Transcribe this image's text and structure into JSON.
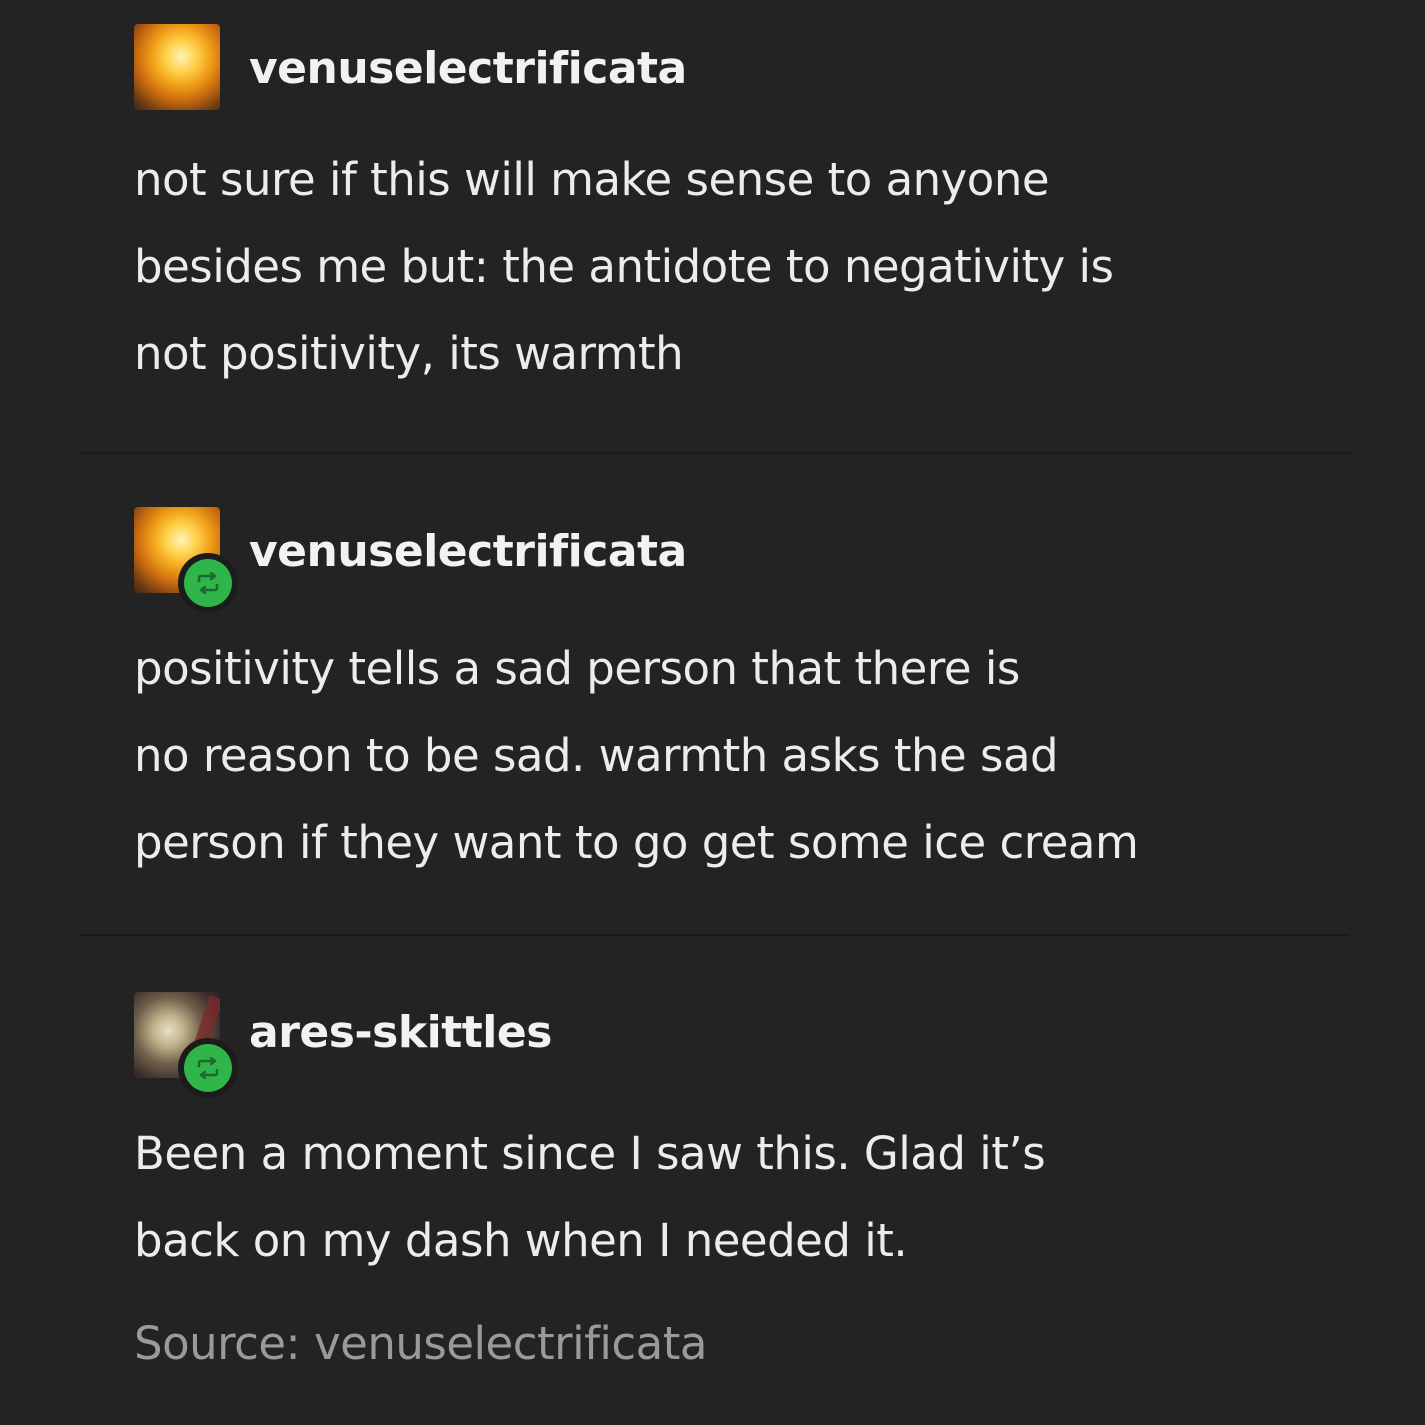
{
  "posts": [
    {
      "username": "venuselectrificata",
      "avatar_icon": "sunset-avatar-icon",
      "reblogged": false,
      "lines": [
        "not sure if this will make sense to anyone",
        "besides me but: the antidote to negativity is",
        "not positivity, its warmth"
      ]
    },
    {
      "username": "venuselectrificata",
      "avatar_icon": "sunset-avatar-icon",
      "reblogged": true,
      "lines": [
        "positivity tells a sad person that there is",
        "no reason to be sad. warmth asks the sad",
        "person if they want to go get some ice cream"
      ]
    },
    {
      "username": "ares-skittles",
      "avatar_icon": "person-avatar-icon",
      "reblogged": true,
      "lines": [
        "Been a moment since I saw this. Glad it’s",
        "back on my dash when I needed it."
      ]
    }
  ],
  "source": {
    "text": "Source: venuselectrificata"
  },
  "colors": {
    "background": "#232323",
    "text": "#ececec",
    "muted_text": "#9a9a9a",
    "reblog_badge": "#2fb54a"
  },
  "icons": {
    "reblog": "reblog-icon"
  }
}
